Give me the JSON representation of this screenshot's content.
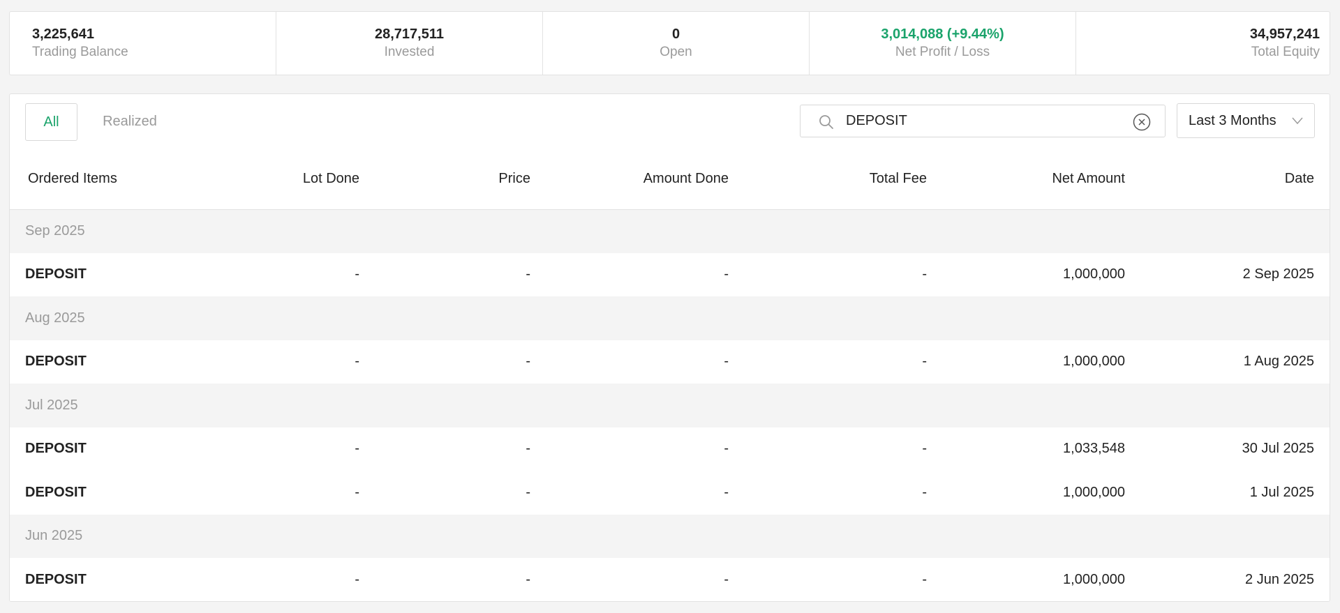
{
  "summary": {
    "trading_balance": {
      "value": "3,225,641",
      "label": "Trading Balance"
    },
    "invested": {
      "value": "28,717,511",
      "label": "Invested"
    },
    "open": {
      "value": "0",
      "label": "Open"
    },
    "net_profit_loss": {
      "value": "3,014,088 (+9.44%)",
      "label": "Net Profit / Loss"
    },
    "total_equity": {
      "value": "34,957,241",
      "label": "Total Equity"
    }
  },
  "tabs": {
    "all": "All",
    "realized": "Realized"
  },
  "search": {
    "value": "DEPOSIT",
    "icon": "search-icon",
    "clear_icon": "clear-icon"
  },
  "period": {
    "label": "Last 3 Months",
    "icon": "chevron-down-icon"
  },
  "table": {
    "headers": [
      "Ordered Items",
      "Lot Done",
      "Price",
      "Amount Done",
      "Total Fee",
      "Net Amount",
      "Date"
    ],
    "groups": [
      {
        "month": "Sep 2025",
        "rows": [
          {
            "item": "DEPOSIT",
            "lot": "-",
            "price": "-",
            "amount": "-",
            "fee": "-",
            "net": "1,000,000",
            "date": "2 Sep 2025"
          }
        ]
      },
      {
        "month": "Aug 2025",
        "rows": [
          {
            "item": "DEPOSIT",
            "lot": "-",
            "price": "-",
            "amount": "-",
            "fee": "-",
            "net": "1,000,000",
            "date": "1 Aug 2025"
          }
        ]
      },
      {
        "month": "Jul 2025",
        "rows": [
          {
            "item": "DEPOSIT",
            "lot": "-",
            "price": "-",
            "amount": "-",
            "fee": "-",
            "net": "1,033,548",
            "date": "30 Jul 2025"
          },
          {
            "item": "DEPOSIT",
            "lot": "-",
            "price": "-",
            "amount": "-",
            "fee": "-",
            "net": "1,000,000",
            "date": "1 Jul 2025"
          }
        ]
      },
      {
        "month": "Jun 2025",
        "rows": [
          {
            "item": "DEPOSIT",
            "lot": "-",
            "price": "-",
            "amount": "-",
            "fee": "-",
            "net": "1,000,000",
            "date": "2 Jun 2025"
          }
        ]
      }
    ]
  },
  "colors": {
    "accent_green": "#1aa36b",
    "link_blue": "#1f74b4",
    "muted_gray": "#9a9a9a"
  }
}
